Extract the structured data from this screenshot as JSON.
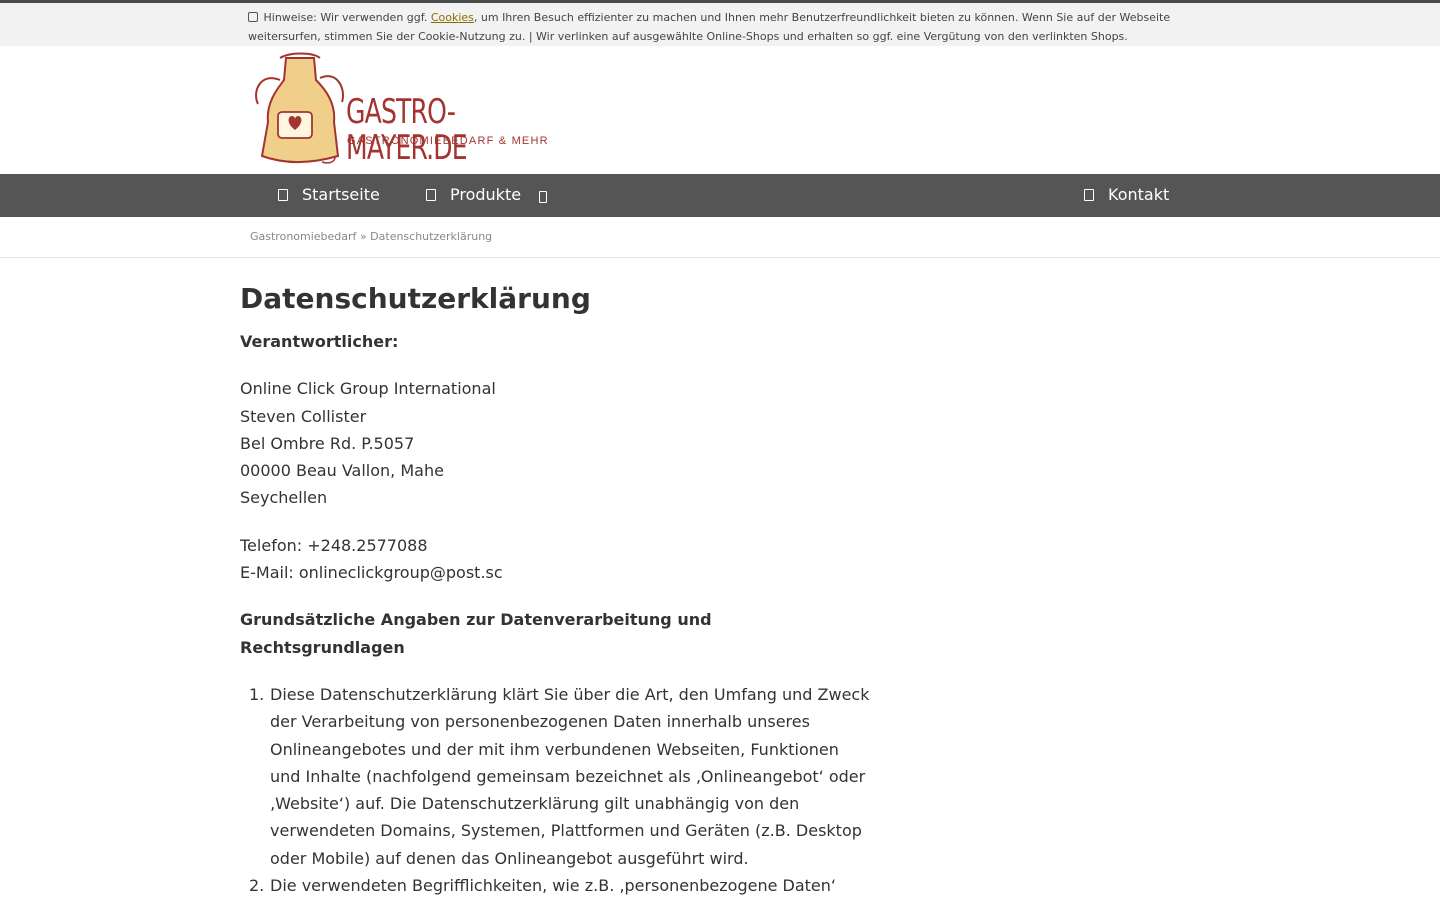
{
  "notice": {
    "text_before": " Hinweise: Wir verwenden ggf. ",
    "cookies_link": "Cookies",
    "text_after": ", um Ihren Besuch effizienter zu machen und Ihnen mehr Benutzerfreundlichkeit bieten zu können. Wenn Sie auf der Webseite weitersurfen, stimmen Sie der Cookie-Nutzung zu. | Wir verlinken auf ausgewählte Online-Shops und erhalten so ggf. eine Vergütung von den verlinkten Shops."
  },
  "logo": {
    "title": "GASTRO-MAYER.DE",
    "subtitle": "GASTRONOMIEBEDARF & MEHR"
  },
  "nav": {
    "home": "Startseite",
    "products": "Produkte",
    "contact": "Kontakt"
  },
  "breadcrumb": {
    "home": "Gastronomiebedarf",
    "separator": "»",
    "current": "Datenschutzerklärung"
  },
  "content": {
    "title": "Datenschutzerklärung",
    "responsible_heading": "Verantwortlicher:",
    "address": [
      "Online Click Group International",
      "Steven Collister",
      "Bel Ombre Rd. P.5057",
      "00000 Beau Vallon, Mahe",
      "Seychellen"
    ],
    "phone": "Telefon: +248.2577088",
    "email": "E-Mail: onlineclickgroup@post.sc",
    "section_heading": "Grundsätzliche Angaben zur Datenverarbeitung und Rechtsgrundlagen",
    "list": [
      {
        "num": "1.",
        "text": "Diese Datenschutzerklärung klärt Sie über die Art, den Umfang und Zweck der Verarbeitung von personenbezogenen Daten innerhalb unseres Onlineangebotes und der mit ihm verbundenen Webseiten, Funktionen und Inhalte (nachfolgend gemeinsam bezeichnet als ‚Onlineangebot‘ oder ‚Website‘) auf. Die Datenschutzerklärung gilt unabhängig von den verwendeten Domains, Systemen, Plattformen und Geräten (z.B. Desktop oder Mobile) auf denen das Onlineangebot ausgeführt wird."
      },
      {
        "num": "2.",
        "text": "Die verwendeten Begrifflichkeiten, wie z.B. ‚personenbezogene Daten‘"
      }
    ]
  },
  "colors": {
    "nav_bg": "#555555",
    "logo_red": "#a3342f",
    "apron_yellow": "#f0cf8a",
    "notice_bg": "#f2f2f2"
  }
}
